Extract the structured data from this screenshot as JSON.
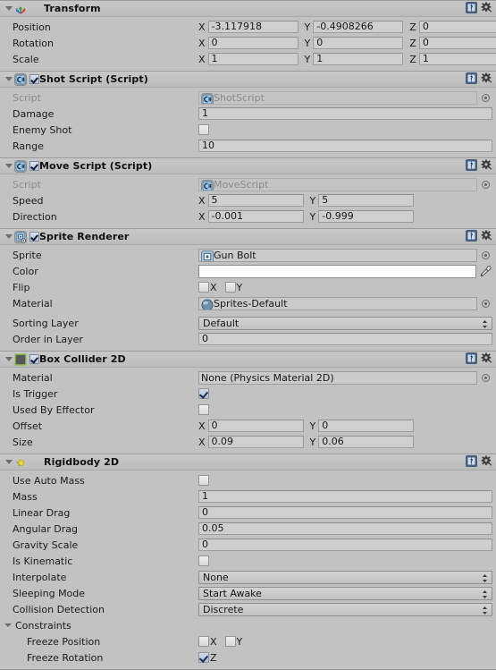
{
  "theme": {
    "background": "#c2c2c2",
    "field_bg": "#cfcfcf",
    "border": "#9d9d9d",
    "text": "#1a1a1a",
    "dim_text": "#8b8b8b",
    "check_blue": "#1d2c50"
  },
  "header_buttons": {
    "help_label": "?",
    "help_name": "help-book-icon",
    "settings_name": "gear-icon"
  },
  "components": [
    {
      "id": "transform",
      "title": "Transform",
      "icon": "transform-axis-icon",
      "has_enable_checkbox": false,
      "enabled": true,
      "rows": [
        {
          "type": "vector3",
          "label": "Position",
          "axes": [
            "X",
            "Y",
            "Z"
          ],
          "values": [
            "-3.117918",
            "-0.4908266",
            "0"
          ]
        },
        {
          "type": "vector3",
          "label": "Rotation",
          "axes": [
            "X",
            "Y",
            "Z"
          ],
          "values": [
            "0",
            "0",
            "0"
          ]
        },
        {
          "type": "vector3",
          "label": "Scale",
          "axes": [
            "X",
            "Y",
            "Z"
          ],
          "values": [
            "1",
            "1",
            "1"
          ]
        }
      ]
    },
    {
      "id": "shot-script",
      "title": "Shot Script (Script)",
      "icon": "csharp-script-icon",
      "has_enable_checkbox": true,
      "enabled": true,
      "rows": [
        {
          "type": "object",
          "label": "Script",
          "value": "ShotScript",
          "disabled": true,
          "icon": "csharp-script-icon"
        },
        {
          "type": "text",
          "label": "Damage",
          "value": "1"
        },
        {
          "type": "checkbox",
          "label": "Enemy Shot",
          "checked": false
        },
        {
          "type": "text",
          "label": "Range",
          "value": "10"
        }
      ]
    },
    {
      "id": "move-script",
      "title": "Move Script (Script)",
      "icon": "csharp-script-icon",
      "has_enable_checkbox": true,
      "enabled": true,
      "rows": [
        {
          "type": "object",
          "label": "Script",
          "value": "MoveScript",
          "disabled": true,
          "icon": "csharp-script-icon"
        },
        {
          "type": "vector2",
          "label": "Speed",
          "axes": [
            "X",
            "Y"
          ],
          "values": [
            "5",
            "5"
          ]
        },
        {
          "type": "vector2",
          "label": "Direction",
          "axes": [
            "X",
            "Y"
          ],
          "values": [
            "-0.001",
            "-0.999"
          ]
        }
      ]
    },
    {
      "id": "sprite-renderer",
      "title": "Sprite Renderer",
      "icon": "sprite-renderer-icon",
      "has_enable_checkbox": true,
      "enabled": true,
      "rows": [
        {
          "type": "object",
          "label": "Sprite",
          "value": "Gun Bolt",
          "disabled": false,
          "icon": "sprite-icon"
        },
        {
          "type": "color",
          "label": "Color",
          "value": "#ffffff",
          "picker": "eyedropper-icon"
        },
        {
          "type": "flip",
          "label": "Flip",
          "options": [
            {
              "axis": "X",
              "checked": false
            },
            {
              "axis": "Y",
              "checked": false
            }
          ]
        },
        {
          "type": "object",
          "label": "Material",
          "value": "Sprites-Default",
          "disabled": false,
          "icon": "material-sphere-icon"
        },
        {
          "type": "popup",
          "label": "Sorting Layer",
          "value": "Default"
        },
        {
          "type": "text",
          "label": "Order in Layer",
          "value": "0"
        }
      ]
    },
    {
      "id": "box-collider-2d",
      "title": "Box Collider 2D",
      "icon": "box-collider-2d-icon",
      "has_enable_checkbox": true,
      "enabled": true,
      "rows": [
        {
          "type": "object",
          "label": "Material",
          "value": "None (Physics Material 2D)",
          "disabled": false,
          "icon": "none-icon"
        },
        {
          "type": "checkbox",
          "label": "Is Trigger",
          "checked": true
        },
        {
          "type": "checkbox",
          "label": "Used By Effector",
          "checked": false
        },
        {
          "type": "vector2",
          "label": "Offset",
          "axes": [
            "X",
            "Y"
          ],
          "values": [
            "0",
            "0"
          ]
        },
        {
          "type": "vector2",
          "label": "Size",
          "axes": [
            "X",
            "Y"
          ],
          "values": [
            "0.09",
            "0.06"
          ]
        }
      ]
    },
    {
      "id": "rigidbody-2d",
      "title": "Rigidbody 2D",
      "icon": "rigidbody-2d-icon",
      "has_enable_checkbox": false,
      "enabled": true,
      "rows": [
        {
          "type": "checkbox",
          "label": "Use Auto Mass",
          "checked": false
        },
        {
          "type": "text",
          "label": "Mass",
          "value": "1"
        },
        {
          "type": "text",
          "label": "Linear Drag",
          "value": "0"
        },
        {
          "type": "text",
          "label": "Angular Drag",
          "value": "0.05"
        },
        {
          "type": "text",
          "label": "Gravity Scale",
          "value": "0"
        },
        {
          "type": "checkbox",
          "label": "Is Kinematic",
          "checked": false
        },
        {
          "type": "popup",
          "label": "Interpolate",
          "value": "None"
        },
        {
          "type": "popup",
          "label": "Sleeping Mode",
          "value": "Start Awake"
        },
        {
          "type": "popup",
          "label": "Collision Detection",
          "value": "Discrete"
        },
        {
          "type": "foldout",
          "label": "Constraints",
          "expanded": true
        },
        {
          "type": "flip",
          "label": "Freeze Position",
          "indent": true,
          "options": [
            {
              "axis": "X",
              "checked": false
            },
            {
              "axis": "Y",
              "checked": false
            }
          ]
        },
        {
          "type": "flip",
          "label": "Freeze Rotation",
          "indent": true,
          "options": [
            {
              "axis": "Z",
              "checked": true
            }
          ]
        }
      ]
    }
  ]
}
